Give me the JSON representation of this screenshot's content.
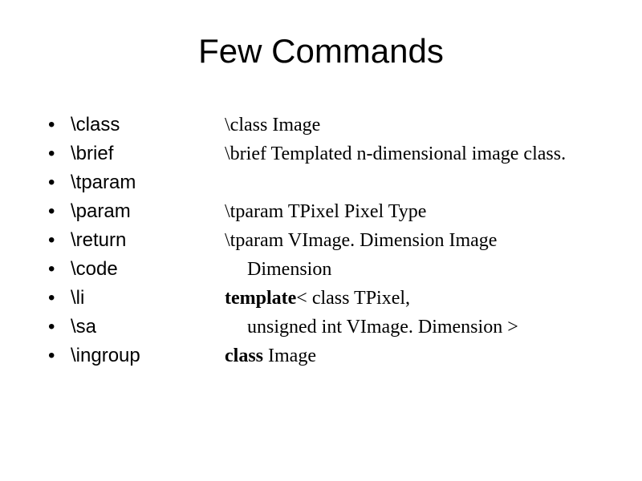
{
  "title": "Few Commands",
  "bullets": [
    "\\class",
    "\\brief",
    "\\tparam",
    "\\param",
    "\\return",
    "\\code",
    "\\li",
    "\\sa",
    "\\ingroup"
  ],
  "example": {
    "line1": "\\class Image",
    "line2": "\\brief Templated n-dimensional image class.",
    "line3": "\\tparam TPixel Pixel Type",
    "line4": "\\tparam VImage. Dimension Image",
    "line4b": "Dimension",
    "line5a": "template",
    "line5b": "< class TPixel,",
    "line6": "unsigned int VImage. Dimension >",
    "line7a": "class ",
    "line7b": "Image"
  }
}
